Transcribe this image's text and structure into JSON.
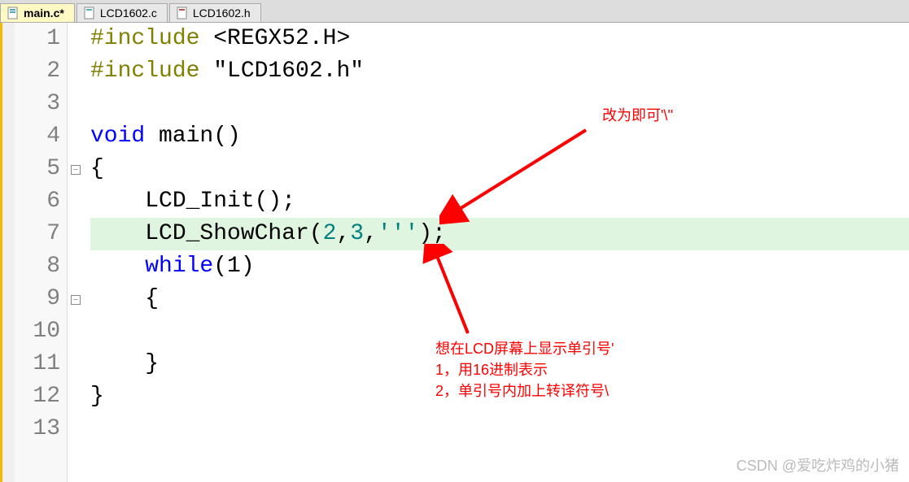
{
  "tabs": [
    {
      "label": "main.c*",
      "active": true
    },
    {
      "label": "LCD1602.c",
      "active": false
    },
    {
      "label": "LCD1602.h",
      "active": false
    }
  ],
  "lines": {
    "count": 13,
    "l1": {
      "preproc": "#include",
      "rest": " <REGX52.H>"
    },
    "l2": {
      "preproc": "#include",
      "rest": " \"LCD1602.h\""
    },
    "l4": {
      "kw": "void",
      "rest": " main()"
    },
    "l5": "{",
    "l6": "    LCD_Init();",
    "l7_a": "    LCD_ShowChar(",
    "l7_n1": "2",
    "l7_c1": ",",
    "l7_n2": "3",
    "l7_c2": ",",
    "l7_q": "'''",
    "l7_b": ");",
    "l8_kw": "while",
    "l8_rest": "(1)",
    "l9": "    {",
    "l11": "    }",
    "l12": "}"
  },
  "annotations": {
    "top": "改为即可'\\''",
    "bottom1": "想在LCD屏幕上显示单引号'",
    "bottom2": "1，用16进制表示",
    "bottom3": "2，单引号内加上转译符号\\"
  },
  "watermark": "CSDN @爱吃炸鸡的小猪"
}
